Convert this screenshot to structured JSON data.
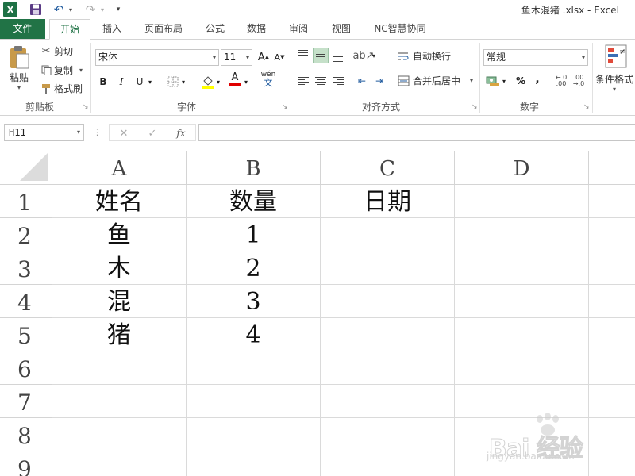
{
  "app": {
    "logo_letter": "X",
    "doc_title": "鱼木混猪 .xlsx - Excel"
  },
  "quick_access": {
    "save_icon": "save-icon",
    "undo_icon": "undo-icon",
    "redo_icon": "redo-icon"
  },
  "tabs": [
    {
      "label": "文件"
    },
    {
      "label": "开始"
    },
    {
      "label": "插入"
    },
    {
      "label": "页面布局"
    },
    {
      "label": "公式"
    },
    {
      "label": "数据"
    },
    {
      "label": "审阅"
    },
    {
      "label": "视图"
    },
    {
      "label": "NC智慧协同"
    }
  ],
  "ribbon": {
    "clipboard": {
      "paste_label": "粘贴",
      "cut_label": "剪切",
      "copy_label": "复制",
      "format_painter_label": "格式刷",
      "group_label": "剪贴板"
    },
    "font": {
      "font_name": "宋体",
      "font_size": "11",
      "bold": "B",
      "italic": "I",
      "underline": "U",
      "grow": "A",
      "shrink": "A",
      "font_color_letter": "A",
      "phonetic": "wén",
      "group_label": "字体"
    },
    "alignment": {
      "wrap_text_label": "自动换行",
      "merge_center_label": "合并后居中",
      "group_label": "对齐方式"
    },
    "number": {
      "format": "常规",
      "percent": "%",
      "comma": ",",
      "group_label": "数字"
    },
    "styles": {
      "conditional_format_label": "条件格式"
    }
  },
  "formula_bar": {
    "name_box": "H11",
    "cancel": "✕",
    "enter": "✓",
    "fx": "fx",
    "formula": ""
  },
  "sheet": {
    "columns": [
      "A",
      "B",
      "C",
      "D"
    ],
    "rows": [
      "1",
      "2",
      "3",
      "4",
      "5",
      "6",
      "7",
      "8",
      "9"
    ],
    "cells": [
      [
        "姓名",
        "数量",
        "日期",
        ""
      ],
      [
        "鱼",
        "1",
        "",
        ""
      ],
      [
        "木",
        "2",
        "",
        ""
      ],
      [
        "混",
        "3",
        "",
        ""
      ],
      [
        "猪",
        "4",
        "",
        ""
      ],
      [
        "",
        "",
        "",
        ""
      ],
      [
        "",
        "",
        "",
        ""
      ],
      [
        "",
        "",
        "",
        ""
      ],
      [
        "",
        "",
        "",
        ""
      ]
    ]
  },
  "watermark": {
    "text": "Bai 经验",
    "url": "jingyan.baidu.com"
  },
  "colors": {
    "excel_green": "#217346",
    "grid_line": "#dadada"
  }
}
